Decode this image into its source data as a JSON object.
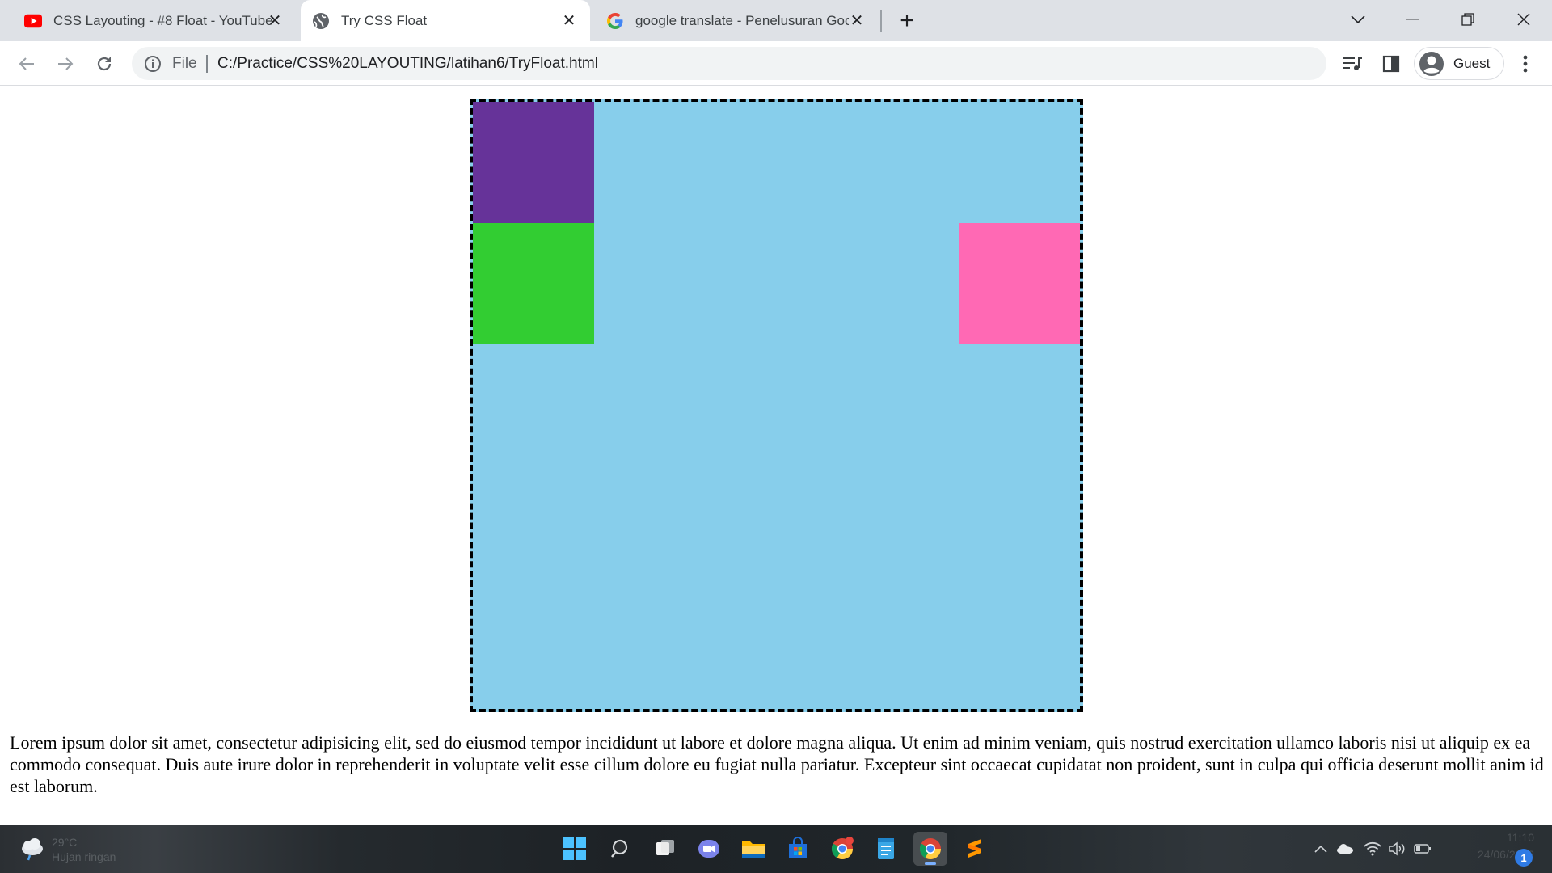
{
  "browser": {
    "tabs": [
      {
        "title": "CSS Layouting - #8 Float - YouTube",
        "favicon": "youtube-icon"
      },
      {
        "title": "Try CSS Float",
        "favicon": "globe-icon"
      },
      {
        "title": "google translate - Penelusuran Goog",
        "favicon": "google-g-icon"
      }
    ],
    "new_tab_label": "+",
    "omnibox": {
      "scheme_label": "File",
      "url": "C:/Practice/CSS%20LAYOUTING/latihan6/TryFloat.html"
    },
    "profile": {
      "name": "Guest"
    }
  },
  "page": {
    "container": {
      "background": "#87ceeb",
      "border": "#000000"
    },
    "boxes": [
      {
        "name": "purple",
        "color": "#663399"
      },
      {
        "name": "green",
        "color": "#32cd32"
      },
      {
        "name": "pink",
        "color": "#ff69b4"
      }
    ],
    "paragraph": "Lorem ipsum dolor sit amet, consectetur adipisicing elit, sed do eiusmod tempor incididunt ut labore et dolore magna aliqua. Ut enim ad minim veniam, quis nostrud exercitation ullamco laboris nisi ut aliquip ex ea commodo consequat. Duis aute irure dolor in reprehenderit in voluptate velit esse cillum dolore eu fugiat nulla pariatur. Excepteur sint occaecat cupidatat non proident, sunt in culpa qui officia deserunt mollit anim id est laborum."
  },
  "taskbar": {
    "weather": {
      "temp": "29°C",
      "condition": "Hujan ringan"
    },
    "apps": [
      "windows-start-icon",
      "search-icon",
      "task-view-icon",
      "teams-chat-icon",
      "file-explorer-icon",
      "microsoft-store-icon",
      "chrome-icon",
      "notepad-icon",
      "chrome-icon",
      "sublime-text-icon"
    ],
    "clock": {
      "time": "11:10",
      "date": "24/06/2022"
    },
    "notifications": "1"
  }
}
